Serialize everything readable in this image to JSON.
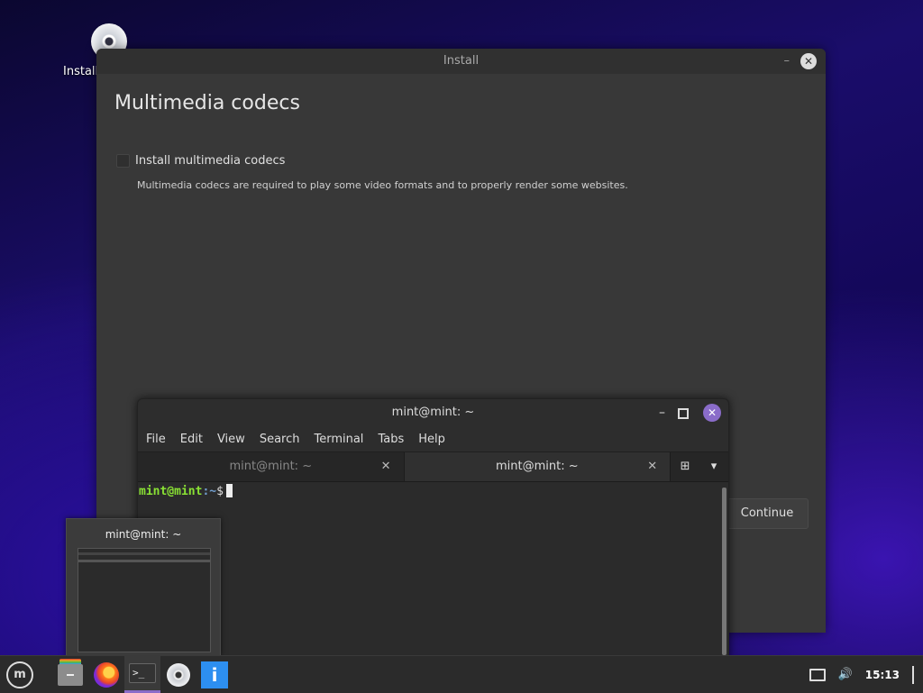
{
  "desktop": {
    "icon_label": "Install"
  },
  "installer": {
    "window_title": "Install",
    "page_title": "Multimedia codecs",
    "checkbox_label": "Install multimedia codecs",
    "checkbox_checked": false,
    "description": "Multimedia codecs are required to play some video formats and to properly render some websites.",
    "continue_label": "Continue"
  },
  "terminal": {
    "window_title": "mint@mint: ~",
    "menu": [
      "File",
      "Edit",
      "View",
      "Search",
      "Terminal",
      "Tabs",
      "Help"
    ],
    "tabs": [
      {
        "label": "mint@mint: ~",
        "active": false
      },
      {
        "label": "mint@mint: ~",
        "active": true
      }
    ],
    "prompt_user": "mint@mint",
    "prompt_path": ":~",
    "prompt_sign": "$"
  },
  "preview": {
    "title": "mint@mint: ~"
  },
  "taskbar": {
    "items": [
      "menu-icon",
      "files-icon",
      "firefox-icon",
      "terminal-icon",
      "install-disc-icon",
      "info-icon"
    ],
    "active_item": "terminal-icon",
    "clock": "15:13",
    "accent": "#8a6cc9"
  }
}
